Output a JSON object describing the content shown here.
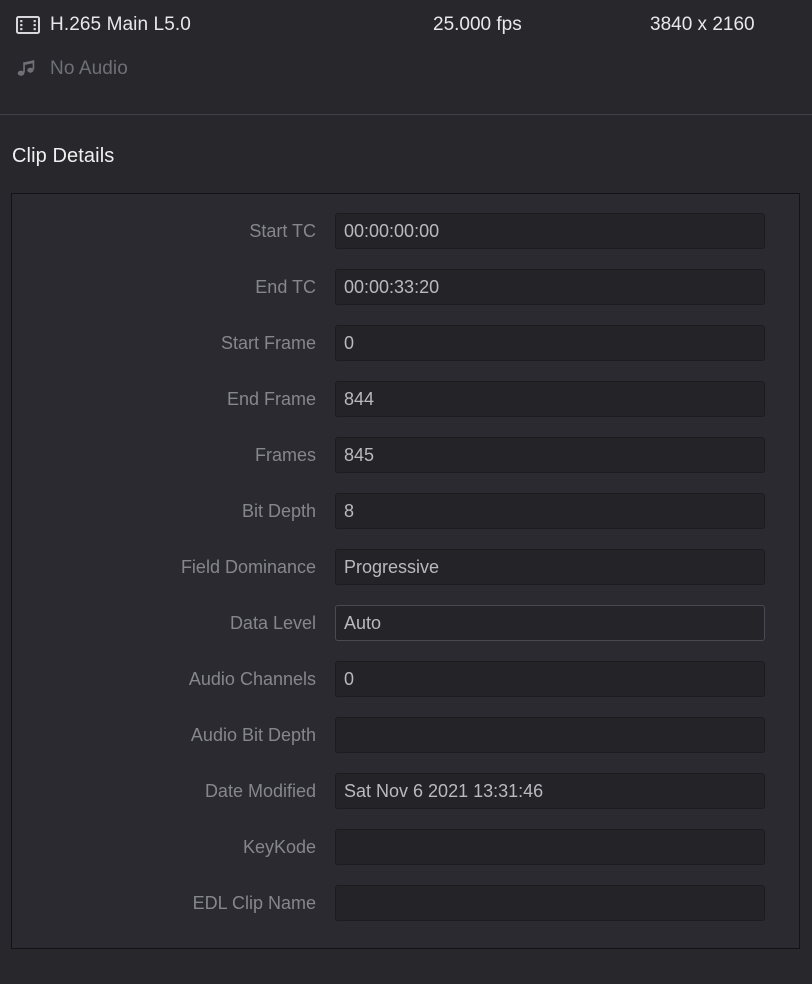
{
  "media_header": {
    "video": {
      "icon": "film-strip-icon",
      "codec": "H.265 Main L5.0",
      "fps": "25.000 fps",
      "resolution": "3840 x 2160"
    },
    "audio": {
      "icon": "music-note-icon",
      "label": "No Audio"
    }
  },
  "clip_details": {
    "title": "Clip Details",
    "rows": [
      {
        "label": "Start TC",
        "value": "00:00:00:00",
        "highlight": false
      },
      {
        "label": "End TC",
        "value": "00:00:33:20",
        "highlight": false
      },
      {
        "label": "Start Frame",
        "value": "0",
        "highlight": false
      },
      {
        "label": "End Frame",
        "value": "844",
        "highlight": false
      },
      {
        "label": "Frames",
        "value": "845",
        "highlight": false
      },
      {
        "label": "Bit Depth",
        "value": "8",
        "highlight": false
      },
      {
        "label": "Field Dominance",
        "value": "Progressive",
        "highlight": false
      },
      {
        "label": "Data Level",
        "value": "Auto",
        "highlight": true
      },
      {
        "label": "Audio Channels",
        "value": "0",
        "highlight": false
      },
      {
        "label": "Audio Bit Depth",
        "value": "",
        "highlight": false
      },
      {
        "label": "Date Modified",
        "value": "Sat Nov 6 2021 13:31:46",
        "highlight": false
      },
      {
        "label": "KeyKode",
        "value": "",
        "highlight": false
      },
      {
        "label": "EDL Clip Name",
        "value": "",
        "highlight": false
      }
    ]
  },
  "colors": {
    "background": "#27272c",
    "panel": "#2a2a30",
    "field": "#232328",
    "label_text": "#86868d",
    "value_text": "#b9b9be",
    "header_text": "#e8e8ea",
    "muted_text": "#6f6f76"
  }
}
